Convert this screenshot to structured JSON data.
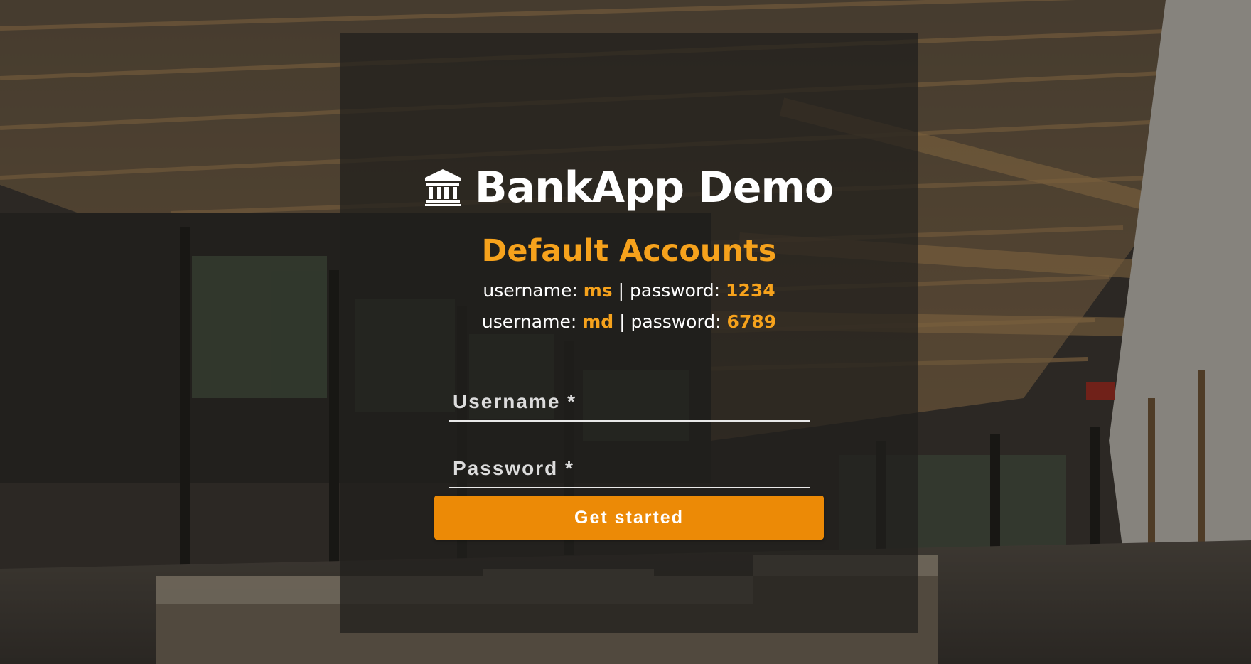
{
  "app": {
    "title": "BankApp Demo",
    "icon": "bank-icon"
  },
  "accounts": {
    "heading": "Default Accounts",
    "username_label": "username: ",
    "password_label": "password: ",
    "separator": " | ",
    "items": [
      {
        "username": "ms",
        "password": "1234"
      },
      {
        "username": "md",
        "password": "6789"
      }
    ]
  },
  "form": {
    "username_placeholder": "Username *",
    "username_value": "",
    "password_placeholder": "Password *",
    "password_value": "",
    "submit_label": "Get started"
  },
  "colors": {
    "accent": "#f6a21c",
    "button": "#ec8a06",
    "panel": "rgba(33,31,29,0.74)",
    "text": "#ffffff"
  }
}
